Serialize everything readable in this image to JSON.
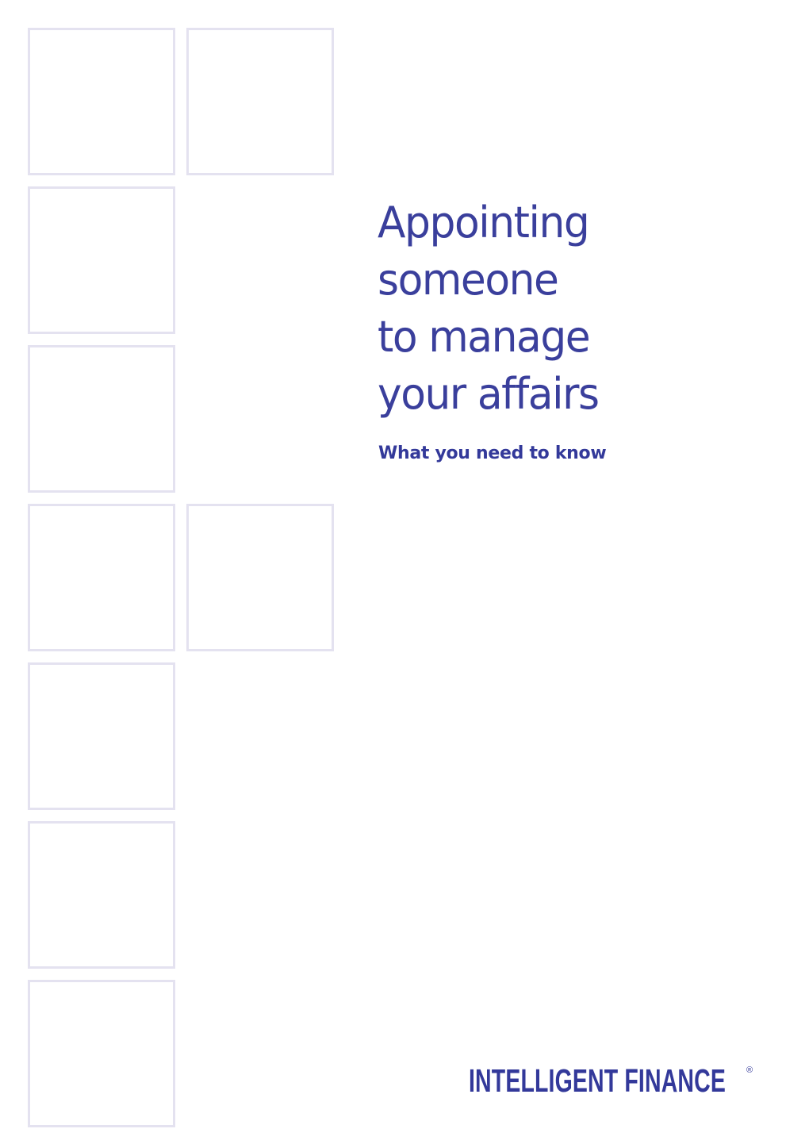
{
  "document": {
    "title_lines": [
      "Appointing",
      "someone",
      "to manage",
      "your affairs"
    ],
    "subtitle": "What you need to know",
    "brand": {
      "name": "INTELLIGENT FINANCE",
      "registered_mark": "®",
      "color": "#33399a"
    },
    "decoration": {
      "tile_border_color": "#e4e2f0",
      "tile_count": 9
    }
  }
}
